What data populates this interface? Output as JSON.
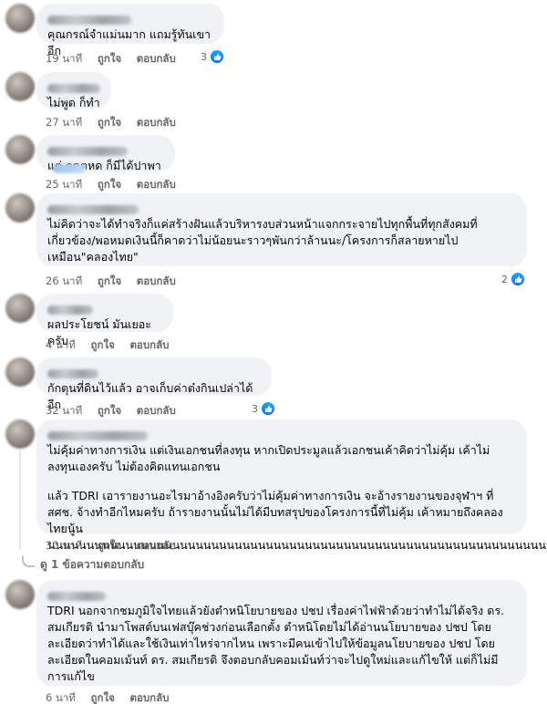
{
  "comments": [
    {
      "text": "คุณกรณ์จำแม่นมาก แถมรู้ทันเขาอีก",
      "time": "19 นาที",
      "like_label": "ถูกใจ",
      "reply_label": "ตอบกลับ",
      "reaction_count": "3"
    },
    {
      "text": "ไม่พูด ก็ทำ",
      "time": "27 นาที",
      "like_label": "ถูกใจ",
      "reply_label": "ตอบกลับ"
    },
    {
      "text": "แต่ กดตหด ก็มีได้ปาพา",
      "time": "25 นาที",
      "like_label": "ถูกใจ",
      "reply_label": "ตอบกลับ"
    },
    {
      "text": "ไม่คิดว่าจะได้ทำจริงก็แค่สร้างฝันแล้วบริหารงบส่วนหน้าแจกกระจายไปทุกพื้นที่ทุกสังคมที่เกี่ยวข้อง/พอหมดเงินนี้ก็คาดว่าไม่น้อยนะราวๆพันกว่าล้านนะ/โครงการก็สลายหายไปเหมือน\"คลองไทย\"",
      "time": "26 นาที",
      "like_label": "ถูกใจ",
      "reply_label": "ตอบกลับ",
      "reaction_count": "2"
    },
    {
      "text": "ผลประโยชน์ มันเยอะครับ",
      "time": "4 นาที",
      "like_label": "ถูกใจ",
      "reply_label": "ตอบกลับ"
    },
    {
      "text": "กักตุนที่ดินไว้แล้ว อาจเก็บค่าต๋งกินเปล่าได้อีก",
      "time": "32 นาที",
      "like_label": "ถูกใจ",
      "reply_label": "ตอบกลับ",
      "reaction_count": "3"
    },
    {
      "paragraphs": [
        "ไม่คุ้มค่าทางการเงิน แต่เงินเอกชนที่ลงทุน หากเปิดประมูลแล้วเอกชนเค้าคิดว่าไม่คุ้ม เค้าไม่ลงทุนเองครับ ไม่ต้องคิดแทนเอกชน",
        "แล้ว TDRI เอารายงานอะไรมาอ้างอิงครับว่าไม่คุ้มค่าทางการเงิน จะอ้างรายงานของจุฬาฯ ที่ สศช. จ้างทำอีกไหมครับ ถ้ารายงานนั้นไม่ได้มีบทสรุปของโครงการนี้ที่ไม่คุ้ม เค้าหมายถึงคลองไทยนู้นนนนนนนนนนนนนนนนนนนนนนนนนนนนนนนนนนนนนนนนนนนนนนนนนนนนนนนนนนนนนนนนนน!"
      ],
      "time": "30 นาที",
      "like_label": "ถูกใจ",
      "reply_label": "ตอบกลับ",
      "replies_label": "ดู 1 ข้อความตอบกลับ"
    },
    {
      "text": "TDRI นอกจากชมภูมิใจไทยแล้วยังตำหนิโยบายของ ปชป เรื่องค่าไฟฟ้าด้วยว่าทำไม่ได้จริง ดร. สมเกียรติ นำมาโพสต์บนเฟสบุ๊คช่วงก่อนเลือกตั้ง ตำหนิโดยไม่ได้อ่านนโยบายของ ปชป โดยละเอียดว่าทำได้และใช้เงินเท่าไหร่จากไหน เพราะมีคนเข้าไปให้ข้อมูลนโยบายของ ปชป โดยละเอียดในคอมเม้นท์ ดร. สมเกียรติ จึงตอบกลับคอมเม้นท์ว่าจะไปดูใหม่และแก้ไขให้ แต่ก็ไม่มีการแก้ไข",
      "time": "6 นาที",
      "like_label": "ถูกใจ",
      "reply_label": "ตอบกลับ"
    }
  ],
  "colors": {
    "bubble": "#f0f2f5",
    "meta": "#65676b",
    "like_blue": "#0866ff"
  },
  "icons": {
    "reaction": "like-thumb-icon",
    "reply_thread": "reply-curve-icon"
  }
}
